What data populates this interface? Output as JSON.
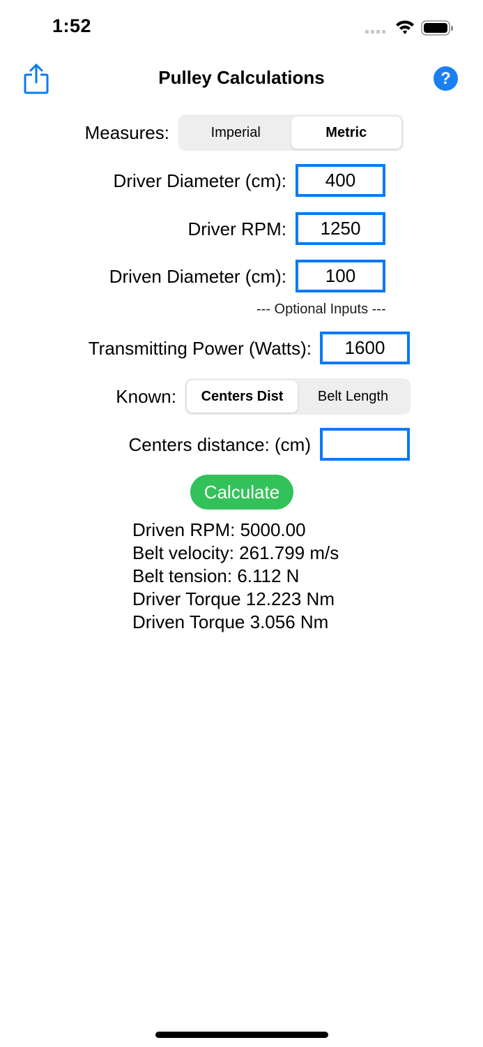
{
  "status_bar": {
    "time": "1:52"
  },
  "nav": {
    "title": "Pulley Calculations",
    "help_label": "?"
  },
  "measures": {
    "label": "Measures:",
    "options": [
      "Imperial",
      "Metric"
    ],
    "selected": "Metric"
  },
  "inputs": {
    "driver_diameter": {
      "label": "Driver Diameter (cm):",
      "value": "400"
    },
    "driver_rpm": {
      "label": "Driver RPM:",
      "value": "1250"
    },
    "driven_diameter": {
      "label": "Driven Diameter (cm):",
      "value": "100"
    }
  },
  "optional_note": "--- Optional Inputs ---",
  "optional_inputs": {
    "transmitting_power": {
      "label": "Transmitting Power (Watts):",
      "value": "1600"
    }
  },
  "known": {
    "label": "Known:",
    "options": [
      "Centers Dist",
      "Belt Length"
    ],
    "selected": "Centers Dist"
  },
  "centers_distance": {
    "label": "Centers distance: (cm)",
    "value": ""
  },
  "calculate_label": "Calculate",
  "results": [
    "Driven RPM: 5000.00",
    "Belt velocity: 261.799 m/s",
    "Belt tension: 6.112 N",
    "Driver Torque 12.223 Nm",
    "Driven Torque 3.056 Nm"
  ],
  "colors": {
    "accent": "#0a7af5",
    "calculate": "#33c25a",
    "segment_bg": "#eeeeef"
  },
  "icons": {
    "share": "share-icon",
    "help": "help-icon",
    "signal": "cellular-signal-icon",
    "wifi": "wifi-icon",
    "battery": "battery-icon"
  }
}
